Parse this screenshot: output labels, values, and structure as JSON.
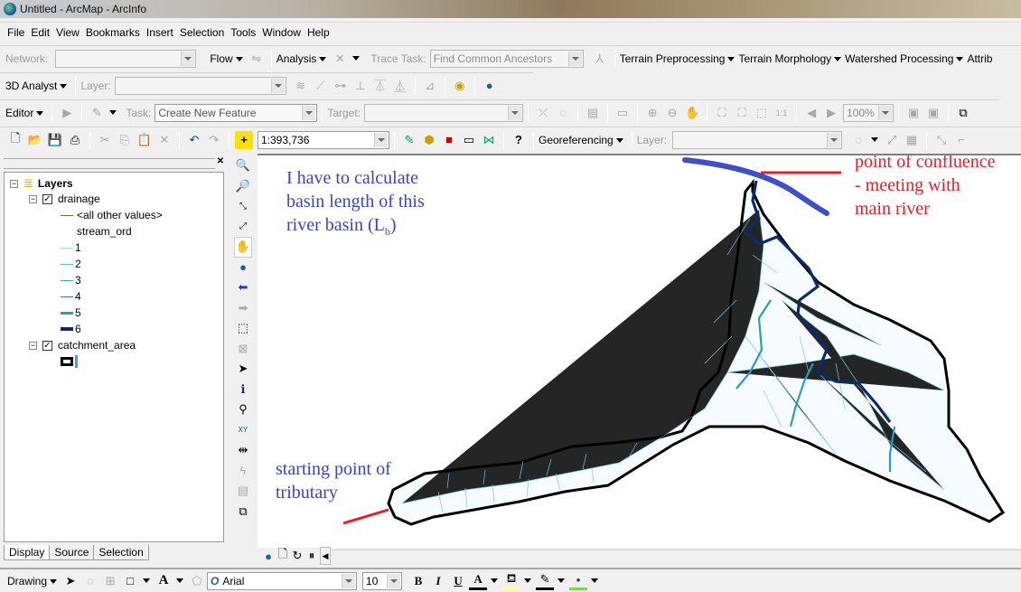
{
  "window": {
    "title": "Untitled - ArcMap - ArcInfo"
  },
  "menu": [
    "File",
    "Edit",
    "View",
    "Bookmarks",
    "Insert",
    "Selection",
    "Tools",
    "Window",
    "Help"
  ],
  "network_toolbar": {
    "network_label": "Network:",
    "network_value": "",
    "flow_label": "Flow",
    "analysis_label": "Analysis",
    "trace_task_label": "Trace Task:",
    "trace_task_value": "Find Common Ancestors",
    "menus": [
      "Terrain Preprocessing",
      "Terrain Morphology",
      "Watershed Processing",
      "Attrib"
    ]
  },
  "analyst_toolbar": {
    "label": "3D Analyst",
    "layer_label": "Layer:",
    "layer_value": ""
  },
  "editor_toolbar": {
    "label": "Editor",
    "task_label": "Task:",
    "task_value": "Create New Feature",
    "target_label": "Target:",
    "target_value": "",
    "zoom_value": "100%"
  },
  "standard_toolbar": {
    "scale_value": "1:393,736",
    "georef_label": "Georeferencing",
    "layer_label": "Layer:",
    "layer_value": ""
  },
  "toc": {
    "root": "Layers",
    "layers": [
      {
        "name": "drainage",
        "checked": true,
        "legend_header": "stream_ord",
        "other": "<all other values>",
        "classes": [
          {
            "label": "1",
            "color": "#9fd9ef"
          },
          {
            "label": "2",
            "color": "#5cc3df"
          },
          {
            "label": "3",
            "color": "#3aa7c8"
          },
          {
            "label": "4",
            "color": "#2c7fa6"
          },
          {
            "label": "5",
            "color": "#2a9ac4"
          },
          {
            "label": "6",
            "color": "#0d2b6b"
          }
        ]
      },
      {
        "name": "catchment_area",
        "checked": true
      }
    ],
    "tabs": [
      "Display",
      "Source",
      "Selection"
    ]
  },
  "annotations": {
    "question": [
      "I have to calculate",
      "basin length of this",
      "river basin (L"
    ],
    "question_sub": "b",
    "question_end": ")",
    "confluence": [
      "point of confluence",
      "- meeting with",
      "main river"
    ],
    "start": [
      "starting point of",
      "tributary"
    ]
  },
  "colors": {
    "annotation_blue": "#3b44c4",
    "annotation_red": "#e0202a",
    "main_river": "#3f4fc8"
  },
  "drawing_toolbar": {
    "label": "Drawing",
    "font": "Arial",
    "font_size": "10",
    "bold": "B",
    "italic": "I",
    "underline": "U",
    "text_color_glyph": "A"
  }
}
